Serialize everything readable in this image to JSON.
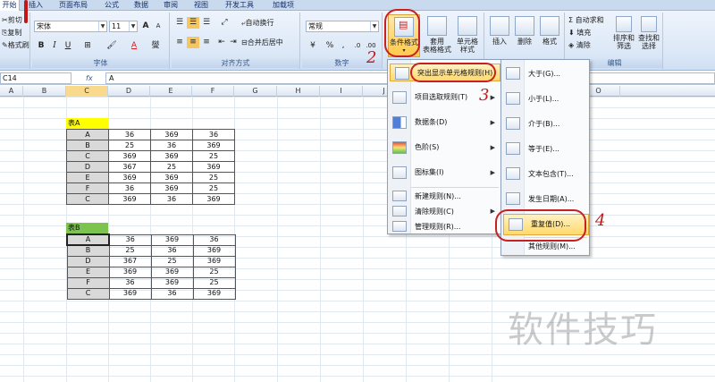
{
  "tabs": [
    "开始",
    "插入",
    "页面布局",
    "公式",
    "数据",
    "审阅",
    "视图",
    "开发工具",
    "加载项"
  ],
  "clipboard": {
    "cut": "剪切",
    "copy": "复制",
    "format_painter": "格式刷"
  },
  "font": {
    "name": "宋体",
    "size": "11",
    "bold": "B",
    "italic": "I",
    "underline": "U",
    "grow": "A",
    "shrink": "A",
    "font_color": "A",
    "group_label": "字体"
  },
  "alignment": {
    "wrap": "自动换行",
    "merge": "合并后居中",
    "group_label": "对齐方式"
  },
  "number": {
    "format": "常规",
    "percent": "%",
    "comma": ",",
    "group_label": "数字"
  },
  "styles": {
    "cond_format": "条件格式",
    "table_format_1": "套用",
    "table_format_2": "表格格式",
    "cell_style_1": "单元格",
    "cell_style_2": "样式"
  },
  "cells": {
    "insert": "插入",
    "delete": "删除",
    "format": "格式"
  },
  "editing": {
    "autosum": "自动求和",
    "fill": "填充",
    "clear": "清除",
    "sort_1": "排序和",
    "sort_2": "筛选",
    "find_1": "查找和",
    "find_2": "选择",
    "group_label": "编辑"
  },
  "formula_bar": {
    "name_box": "C14",
    "fx": "fx",
    "content": "A"
  },
  "columns": [
    "A",
    "B",
    "C",
    "D",
    "E",
    "F",
    "G",
    "H",
    "I",
    "J",
    "K",
    "L",
    "M",
    "N",
    "O"
  ],
  "table_a": {
    "title": "表A",
    "title_color": "#ffff00",
    "rows": [
      [
        "A",
        "36",
        "369",
        "36"
      ],
      [
        "B",
        "25",
        "36",
        "369"
      ],
      [
        "C",
        "369",
        "369",
        "25"
      ],
      [
        "D",
        "367",
        "25",
        "369"
      ],
      [
        "E",
        "369",
        "369",
        "25"
      ],
      [
        "F",
        "36",
        "369",
        "25"
      ],
      [
        "C",
        "369",
        "36",
        "369"
      ]
    ]
  },
  "table_b": {
    "title": "表B",
    "title_color": "#7cc44f",
    "rows": [
      [
        "A",
        "36",
        "369",
        "36"
      ],
      [
        "B",
        "25",
        "36",
        "369"
      ],
      [
        "D",
        "367",
        "25",
        "369"
      ],
      [
        "E",
        "369",
        "369",
        "25"
      ],
      [
        "F",
        "36",
        "369",
        "25"
      ],
      [
        "C",
        "369",
        "36",
        "369"
      ]
    ]
  },
  "menu_main": [
    "突出显示单元格规则(H)",
    "项目选取规则(T)",
    "数据条(D)",
    "色阶(S)",
    "图标集(I)",
    "新建规则(N)...",
    "清除规则(C)",
    "管理规则(R)..."
  ],
  "menu_sub": [
    "大于(G)...",
    "小于(L)...",
    "介于(B)...",
    "等于(E)...",
    "文本包含(T)...",
    "发生日期(A)...",
    "重复值(D)...",
    "其他规则(M)..."
  ],
  "annotations": [
    "1",
    "2",
    "3",
    "4"
  ],
  "watermark": "软件技巧"
}
